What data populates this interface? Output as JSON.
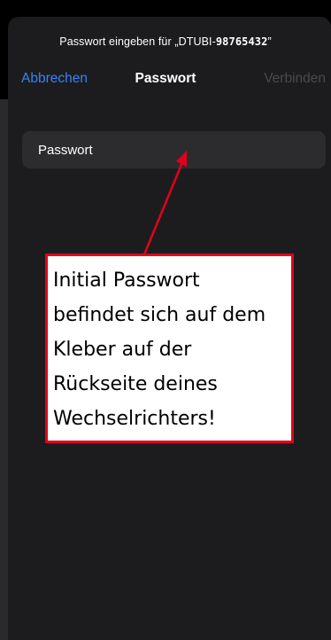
{
  "header": {
    "prompt_prefix": "Passwort eingeben für „DTUBI-",
    "prompt_ssid": "98765432",
    "prompt_suffix": "”"
  },
  "nav": {
    "cancel_label": "Abbrechen",
    "title": "Passwort",
    "connect_label": "Verbinden"
  },
  "password_field": {
    "placeholder": "Passwort",
    "value": ""
  },
  "annotation": {
    "text": "Initial Passwort\nbefindet sich auf dem\nKleber auf der\nRückseite deines\nWechselrichters!",
    "border_color": "#e3001b",
    "arrow_color": "#e3001b"
  },
  "colors": {
    "sheet_background": "#1c1c1e",
    "field_background": "#2c2c2e",
    "accent_blue": "#3a82f7",
    "disabled_gray": "#4a4a4e"
  }
}
